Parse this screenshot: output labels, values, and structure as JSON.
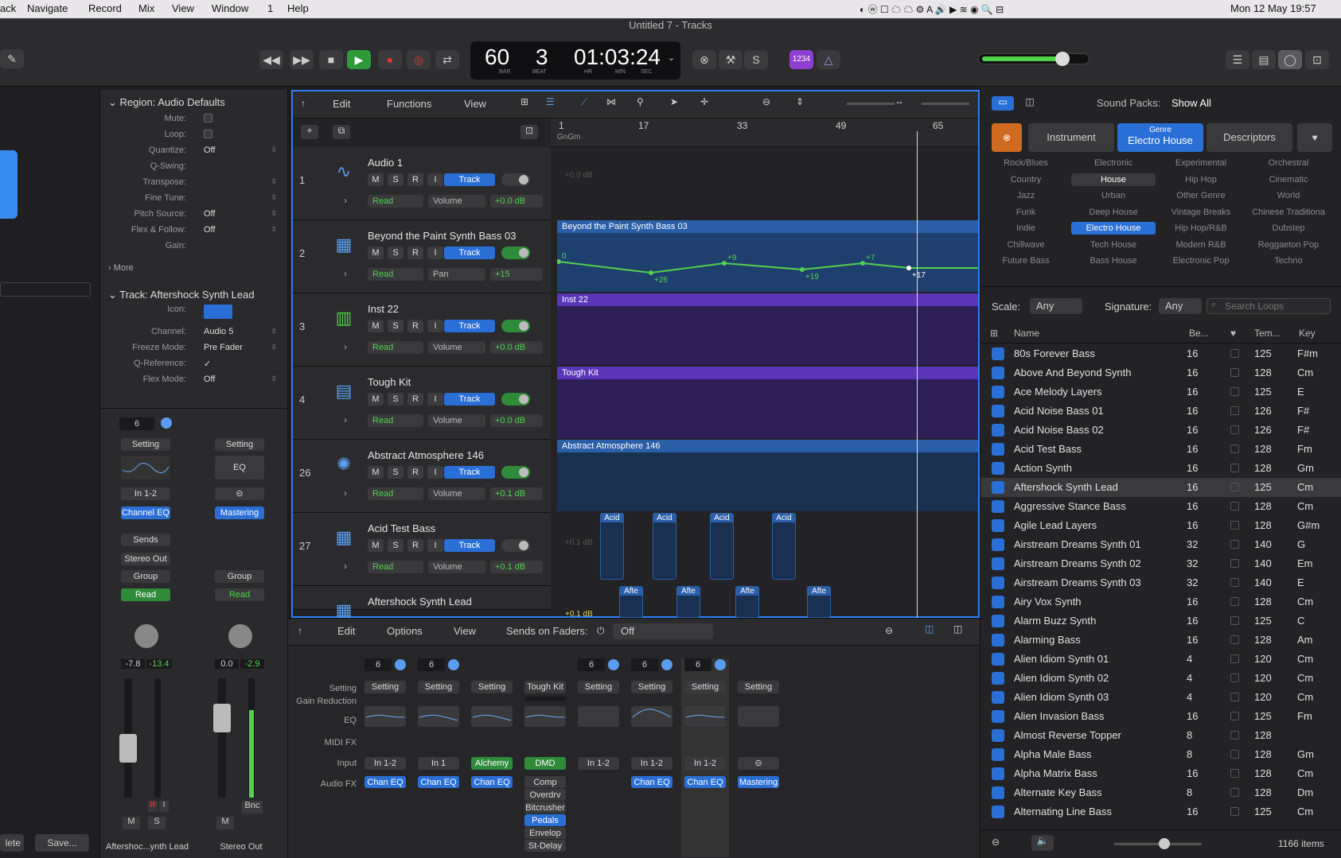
{
  "menubar": {
    "items": [
      "ack",
      "Navigate",
      "Record",
      "Mix",
      "View",
      "Window",
      "1",
      "Help"
    ],
    "datetime": "Mon 12 May  19:57"
  },
  "window_title": "Untitled 7 - Tracks",
  "lcd": {
    "bar": "60",
    "beat": "3",
    "time": "01:03:24",
    "bar_lbl": "BAR",
    "beat_lbl": "BEAT",
    "hr_lbl": "HR",
    "min_lbl": "MIN",
    "sec_lbl": "SEC"
  },
  "toolbar": {
    "count_in": "1234"
  },
  "inspector": {
    "region_title": "Region: Audio Defaults",
    "region_rows": [
      {
        "label": "Mute:",
        "value": ""
      },
      {
        "label": "Loop:",
        "value": ""
      },
      {
        "label": "Quantize:",
        "value": "Off"
      },
      {
        "label": "Q-Swing:",
        "value": ""
      },
      {
        "label": "Transpose:",
        "value": ""
      },
      {
        "label": "Fine Tune:",
        "value": ""
      },
      {
        "label": "Pitch Source:",
        "value": "Off"
      },
      {
        "label": "Flex & Follow:",
        "value": "Off"
      },
      {
        "label": "Gain:",
        "value": ""
      }
    ],
    "more": "More",
    "track_title": "Track:  Aftershock Synth Lead",
    "track_rows": [
      {
        "label": "Icon:",
        "value": ""
      },
      {
        "label": "Channel:",
        "value": "Audio 5"
      },
      {
        "label": "Freeze Mode:",
        "value": "Pre Fader"
      },
      {
        "label": "Q-Reference:",
        "value": "✓"
      },
      {
        "label": "Flex Mode:",
        "value": "Off"
      }
    ],
    "strip1": {
      "num": "6",
      "setting": "Setting",
      "input": "In 1-2",
      "eq": "Channel EQ",
      "sends": "Sends",
      "output": "Stereo Out",
      "group": "Group",
      "read": "Read",
      "vol": "-7.8",
      "peak": "-13.4",
      "name": "Aftershoc...ynth Lead",
      "m": "M",
      "s": "S",
      "r": "R",
      "i": "I"
    },
    "strip2": {
      "setting": "Setting",
      "eq_lbl": "EQ",
      "fx": "Mastering",
      "group": "Group",
      "read": "Read",
      "vol": "0.0",
      "peak": "-2.9",
      "bnc": "Bnc",
      "name": "Stereo Out",
      "m": "M"
    }
  },
  "left_footer": {
    "delete": "lete",
    "save": "Save..."
  },
  "tracks_menu": {
    "edit": "Edit",
    "functions": "Functions",
    "view": "View"
  },
  "ruler": [
    "1",
    "17",
    "33",
    "49",
    "65"
  ],
  "tracks": [
    {
      "num": "1",
      "name": "Audio 1",
      "automation": "Volume",
      "value": "+0.0 dB",
      "toggle": "off"
    },
    {
      "num": "2",
      "name": "Beyond the Paint Synth Bass 03",
      "automation": "Pan",
      "value": "+15",
      "toggle": "on"
    },
    {
      "num": "3",
      "name": "Inst 22",
      "automation": "Volume",
      "value": "+0.0 dB",
      "toggle": "on"
    },
    {
      "num": "4",
      "name": "Tough Kit",
      "automation": "Volume",
      "value": "+0.0 dB",
      "toggle": "on"
    },
    {
      "num": "26",
      "name": "Abstract Atmosphere 146",
      "automation": "Volume",
      "value": "+0.1 dB",
      "toggle": "on"
    },
    {
      "num": "27",
      "name": "Acid Test Bass",
      "automation": "Volume",
      "value": "+0.1 dB",
      "toggle": "off"
    },
    {
      "num": "",
      "name": "Aftershock Synth Lead",
      "automation": "",
      "value": "",
      "toggle": "off"
    }
  ],
  "track_labels": {
    "read": "Read",
    "track": "Track",
    "m": "M",
    "s": "S",
    "r": "R",
    "i": "I"
  },
  "regions": {
    "r1_db": "+0.0 dB",
    "r2": "Beyond the Paint Synth Bass 03",
    "r2_points": [
      "0",
      "+26",
      "+9",
      "+19",
      "+7",
      "+17"
    ],
    "r3": "Inst 22",
    "r4": "Tough Kit",
    "r5": "Abstract Atmosphere 146",
    "acid": "Acid",
    "afte": "Afte",
    "r6_db": "+0.1 dB",
    "r7_db": "+0.1 dB",
    "marker": "GnGm"
  },
  "mixer_bar": {
    "edit": "Edit",
    "options": "Options",
    "view": "View",
    "sends_lbl": "Sends on Faders:",
    "sends_val": "Off"
  },
  "mixer_rows": [
    "Setting",
    "Gain Reduction",
    "EQ",
    "MIDI FX",
    "Input",
    "Audio FX"
  ],
  "mixer_channels": [
    {
      "num": "6",
      "setting": "Setting",
      "input": "In 1-2",
      "fx": [
        "Chan EQ"
      ]
    },
    {
      "num": "6",
      "setting": "Setting",
      "input": "In 1",
      "fx": [
        "Chan EQ"
      ]
    },
    {
      "num": "",
      "setting": "Setting",
      "input": "Alchemy",
      "fx": [
        "Chan EQ"
      ]
    },
    {
      "num": "",
      "setting": "Tough Kit",
      "input": "DMD",
      "fx": [
        "Comp",
        "Overdrv",
        "Bitcrusher",
        "Pedals",
        "Envelop",
        "St-Delay"
      ]
    },
    {
      "num": "6",
      "setting": "Setting",
      "input": "In 1-2",
      "fx": []
    },
    {
      "num": "6",
      "setting": "Setting",
      "input": "In 1-2",
      "fx": [
        "Chan EQ"
      ]
    },
    {
      "num": "6",
      "setting": "Setting",
      "input": "In 1-2",
      "fx": [
        "Chan EQ"
      ]
    },
    {
      "num": "",
      "setting": "Setting",
      "input": "",
      "fx": [
        "Mastering"
      ]
    }
  ],
  "browser": {
    "sound_packs_lbl": "Sound Packs:",
    "sound_packs_val": "Show All",
    "tab_instrument": "Instrument",
    "tab_genre_top": "Genre",
    "tab_genre": "Electro House",
    "tab_descriptors": "Descriptors",
    "genres": [
      "Rock/Blues",
      "Electronic",
      "Experimental",
      "Orchestral",
      "Country",
      "House",
      "Hip Hop",
      "Cinematic",
      "Jazz",
      "Urban",
      "Other Genre",
      "World",
      "Funk",
      "Deep House",
      "Vintage Breaks",
      "Chinese Traditiona",
      "Indie",
      "Electro House",
      "Hip Hop/R&B",
      "Dubstep",
      "Chillwave",
      "Tech House",
      "Modern R&B",
      "Reggaeton Pop",
      "Future Bass",
      "Bass House",
      "Electronic Pop",
      "Techno"
    ],
    "scale_lbl": "Scale:",
    "scale_val": "Any",
    "sig_lbl": "Signature:",
    "sig_val": "Any",
    "search_placeholder": "Search Loops",
    "cols": {
      "name": "Name",
      "beats": "Be...",
      "tempo": "Tem...",
      "key": "Key"
    },
    "loops": [
      [
        "80s Forever Bass",
        "16",
        "125",
        "F#m"
      ],
      [
        "Above And Beyond Synth",
        "16",
        "128",
        "Cm"
      ],
      [
        "Ace Melody Layers",
        "16",
        "125",
        "E"
      ],
      [
        "Acid Noise Bass 01",
        "16",
        "126",
        "F#"
      ],
      [
        "Acid Noise Bass 02",
        "16",
        "126",
        "F#"
      ],
      [
        "Acid Test Bass",
        "16",
        "128",
        "Fm"
      ],
      [
        "Action Synth",
        "16",
        "128",
        "Gm"
      ],
      [
        "Aftershock Synth Lead",
        "16",
        "125",
        "Cm"
      ],
      [
        "Aggressive Stance Bass",
        "16",
        "128",
        "Cm"
      ],
      [
        "Agile Lead Layers",
        "16",
        "128",
        "G#m"
      ],
      [
        "Airstream Dreams Synth 01",
        "32",
        "140",
        "G"
      ],
      [
        "Airstream Dreams Synth 02",
        "32",
        "140",
        "Em"
      ],
      [
        "Airstream Dreams Synth 03",
        "32",
        "140",
        "E"
      ],
      [
        "Airy Vox Synth",
        "16",
        "128",
        "Cm"
      ],
      [
        "Alarm Buzz Synth",
        "16",
        "125",
        "C"
      ],
      [
        "Alarming Bass",
        "16",
        "128",
        "Am"
      ],
      [
        "Alien Idiom Synth 01",
        "4",
        "120",
        "Cm"
      ],
      [
        "Alien Idiom Synth 02",
        "4",
        "120",
        "Cm"
      ],
      [
        "Alien Idiom Synth 03",
        "4",
        "120",
        "Cm"
      ],
      [
        "Alien Invasion Bass",
        "16",
        "125",
        "Fm"
      ],
      [
        "Almost Reverse Topper",
        "8",
        "128",
        ""
      ],
      [
        "Alpha Male Bass",
        "8",
        "128",
        "Gm"
      ],
      [
        "Alpha Matrix Bass",
        "16",
        "128",
        "Cm"
      ],
      [
        "Alternate Key Bass",
        "8",
        "128",
        "Dm"
      ],
      [
        "Alternating Line Bass",
        "16",
        "125",
        "Cm"
      ]
    ],
    "count": "1166 items"
  }
}
